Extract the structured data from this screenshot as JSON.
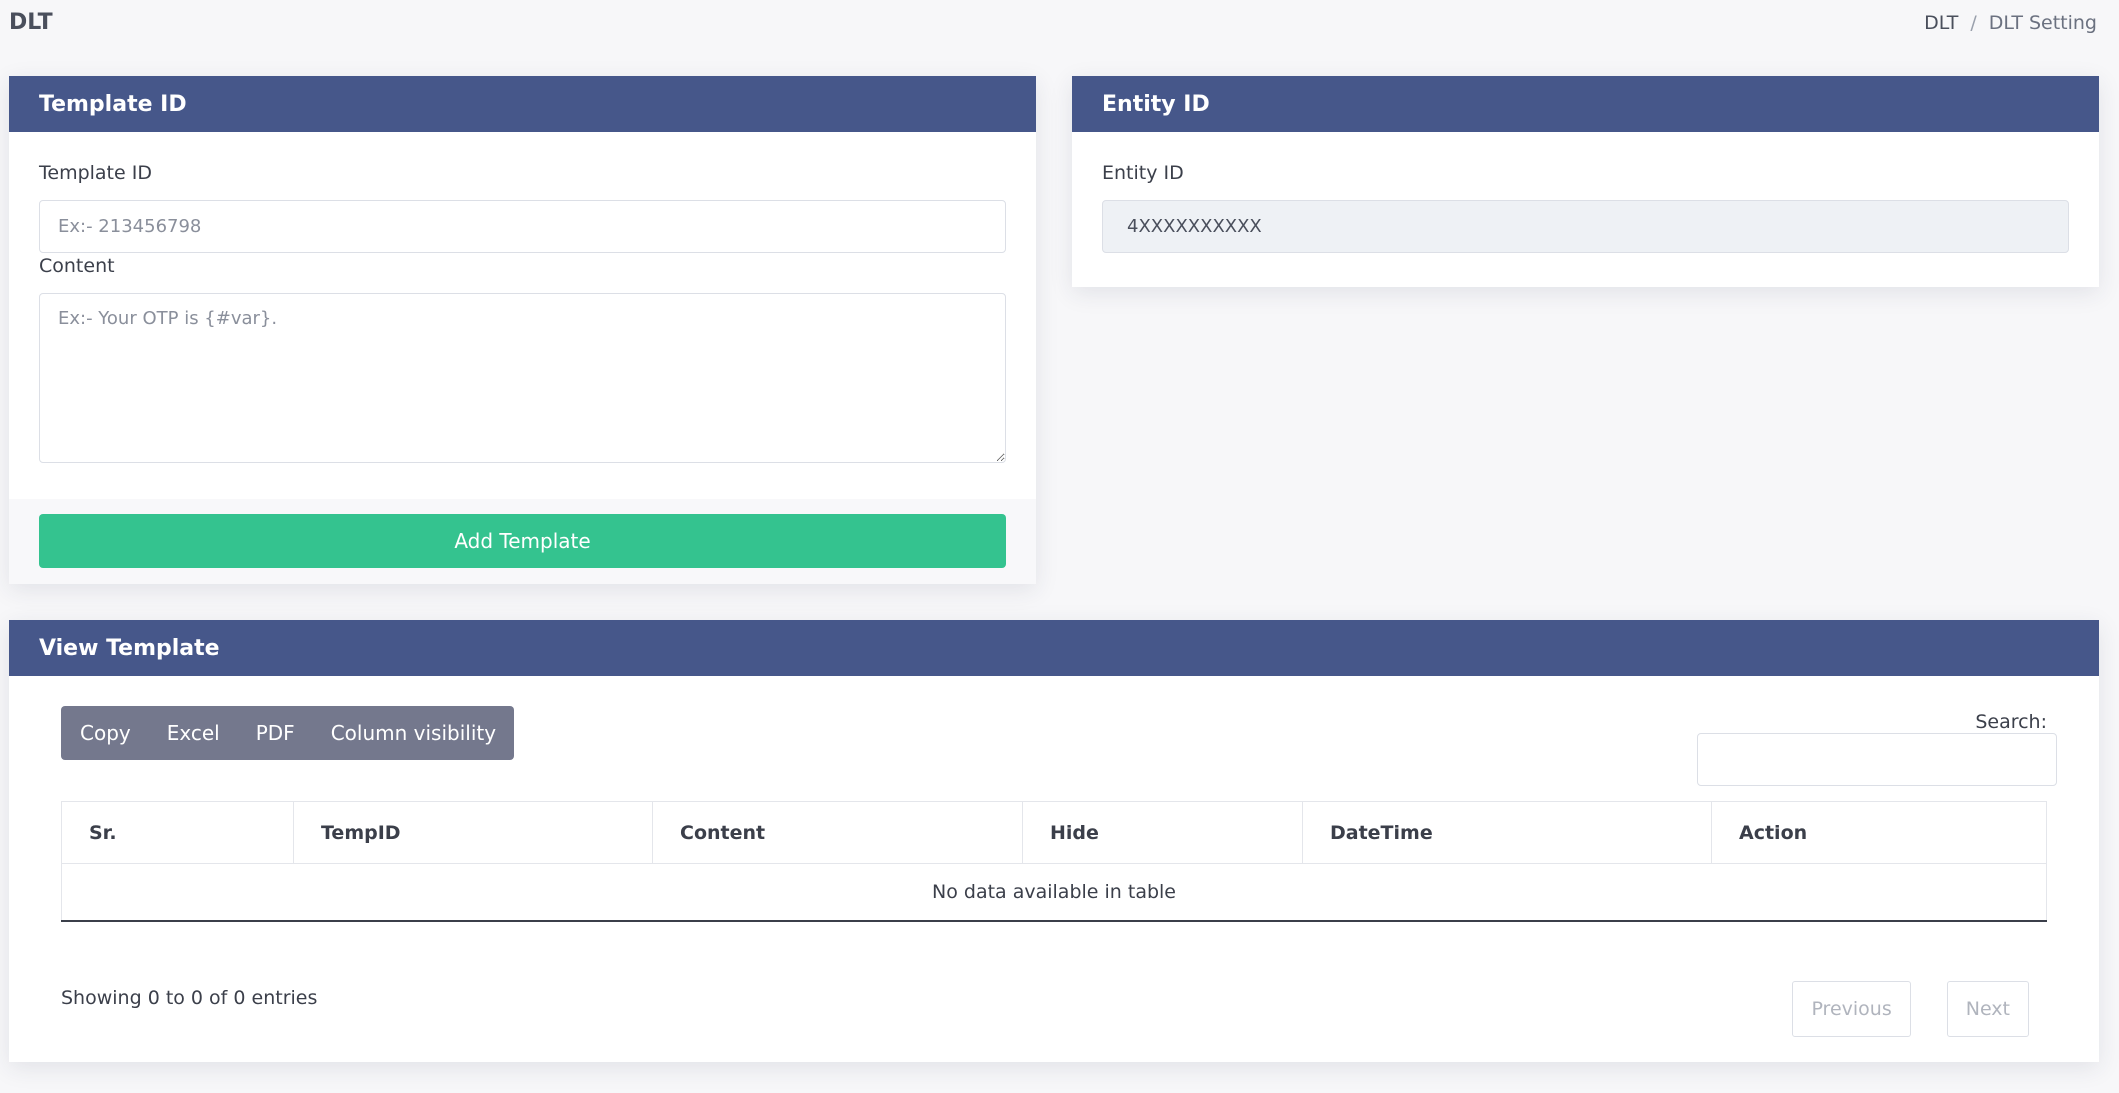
{
  "header": {
    "title": "DLT",
    "breadcrumb": [
      "DLT",
      "DLT Setting"
    ],
    "breadcrumb_separator": "/"
  },
  "template_card": {
    "title": "Template ID",
    "template_id_label": "Template ID",
    "template_id_placeholder": "Ex:- 213456798",
    "content_label": "Content",
    "content_placeholder": "Ex:- Your OTP is {#var}.",
    "add_button": "Add Template"
  },
  "entity_card": {
    "title": "Entity ID",
    "label": "Entity ID",
    "value": "4XXXXXXXXXX"
  },
  "view_card": {
    "title": "View Template",
    "buttons": [
      "Copy",
      "Excel",
      "PDF",
      "Column visibility"
    ],
    "search_label": "Search:",
    "columns": [
      "Sr.",
      "TempID",
      "Content",
      "Hide",
      "DateTime",
      "Action"
    ],
    "empty_message": "No data available in table",
    "info": "Showing 0 to 0 of 0 entries",
    "prev": "Previous",
    "next": "Next"
  },
  "colors": {
    "header": "#46578a",
    "primary_button": "#34c38f",
    "secondary_button": "#74788d"
  }
}
